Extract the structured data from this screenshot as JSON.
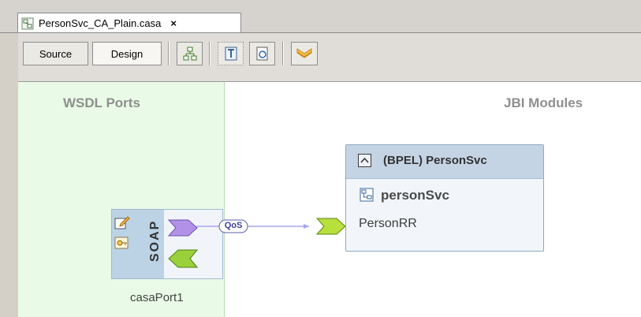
{
  "window": {
    "tab_title": "PersonSvc_CA_Plain.casa",
    "tab_close": "×",
    "tab_icon": "casa-file-icon"
  },
  "toolbar": {
    "source_label": "Source",
    "design_label": "Design",
    "active_view": "Design",
    "icons": [
      "auto-layout-icon",
      "build-icon",
      "deploy-icon",
      "validate-icon"
    ]
  },
  "canvas": {
    "wsdl_header": "WSDL Ports",
    "jbi_header": "JBI Modules",
    "soap_port": {
      "binding_label": "SOAP",
      "caption": "casaPort1",
      "icons": [
        "edit-icon",
        "binding-icon",
        "provide-endpoint-icon",
        "consume-endpoint-icon"
      ]
    },
    "connection": {
      "badge": "QoS"
    },
    "module": {
      "title": "(BPEL) PersonSvc",
      "service_name": "personSvc",
      "endpoint": "PersonRR",
      "icons": [
        "collapse-icon",
        "service-unit-icon",
        "consume-endpoint-icon"
      ]
    }
  },
  "colors": {
    "wsdl_pane": "#e9fbe6",
    "module_header": "#c5d4e4",
    "soap_bar": "#bcd3e6",
    "provide_chevron": "#b292e8",
    "consume_chevron": "#9ad13b",
    "connection_line": "#a9a6ef"
  }
}
